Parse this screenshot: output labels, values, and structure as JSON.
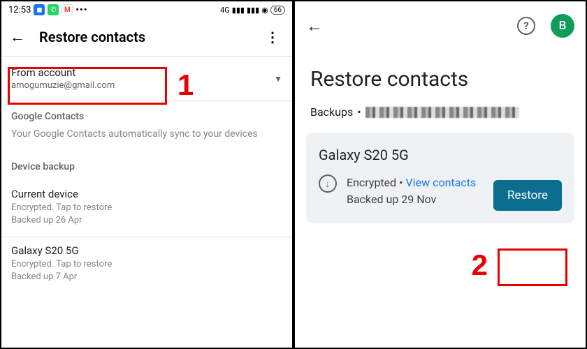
{
  "statusbar": {
    "time": "12:53",
    "network_label": "4G",
    "battery": "66"
  },
  "left": {
    "title": "Restore contacts",
    "account": {
      "label": "From account",
      "email": "amogumuzie@gmail.com"
    },
    "google_contacts": {
      "heading": "Google Contacts",
      "text": "Your Google Contacts automatically sync to your devices"
    },
    "device_backup_heading": "Device backup",
    "devices": [
      {
        "title": "Current device",
        "line1": "Encrypted. Tap to restore",
        "line2": "Backed up 26 Apr"
      },
      {
        "title": "Galaxy S20 5G",
        "line1": "Encrypted. Tap to restore",
        "line2": "Backed up 7 Apr"
      }
    ],
    "annotation": "1"
  },
  "right": {
    "avatar_initial": "B",
    "title": "Restore contacts",
    "backups_label": "Backups",
    "card": {
      "device": "Galaxy S20 5G",
      "encrypted": "Encrypted",
      "view_link": "View contacts",
      "backed_up": "Backed up 29 Nov",
      "restore_button": "Restore"
    },
    "annotation": "2"
  }
}
